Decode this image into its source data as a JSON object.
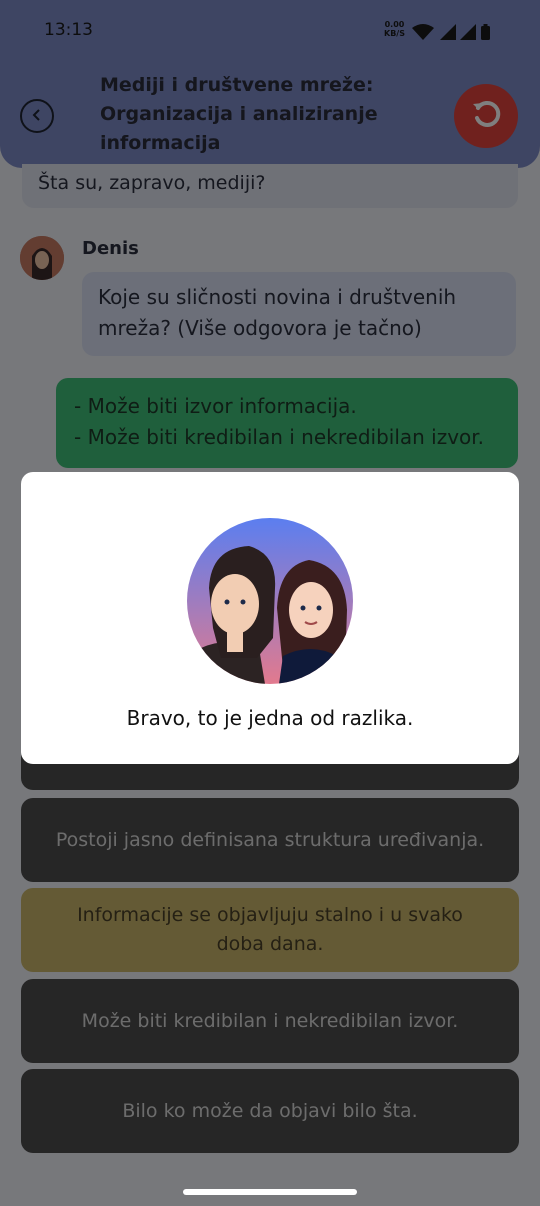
{
  "status_bar": {
    "time": "13:13",
    "net_speed": "0.00",
    "net_unit": "KB/S"
  },
  "header": {
    "title": "Mediji i društvene mreže: Organizacija i analiziranje informacija",
    "back_icon": "back-arrow-icon",
    "reset_icon": "reset-icon"
  },
  "chat": {
    "previous_message": "Šta su, zapravo, mediji?",
    "sender": "Denis",
    "question": "Koje su sličnosti novina i društvenih mreža? (Više odgovora je tačno)",
    "answer_lines": [
      "- Može biti izvor informacija.",
      "- Može biti kredibilan i nekredibilan izvor."
    ]
  },
  "options": [
    {
      "label": "Postoji jasno definisana struktura uređivanja."
    },
    {
      "label": "Informacije se objavljuju stalno i u svako doba dana."
    },
    {
      "label": "Može biti kredibilan i nekredibilan izvor."
    },
    {
      "label": "Bilo ko može da objavi bilo šta."
    }
  ],
  "modal": {
    "message": "Bravo, to je jedna od razlika."
  },
  "colors": {
    "header": "#7d8ac6",
    "reset": "#e0433c",
    "answer": "#3ebf78",
    "option_dark": "#4d4d4d",
    "option_selected": "#c9b56a"
  }
}
